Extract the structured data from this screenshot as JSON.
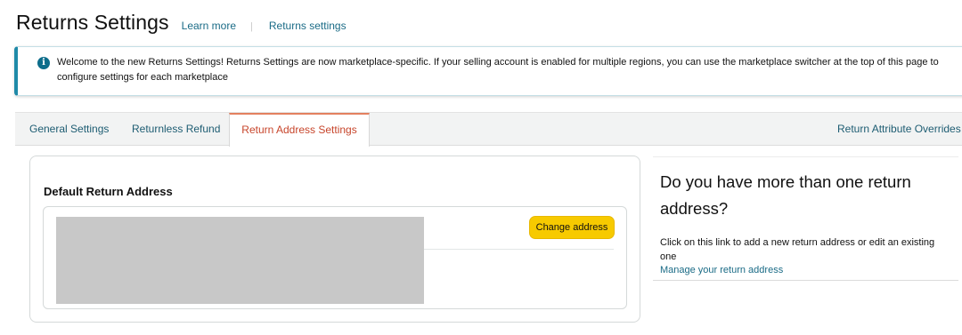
{
  "header": {
    "title": "Returns Settings",
    "learn_more": "Learn more",
    "separator": "|",
    "returns_settings_link": "Returns settings"
  },
  "alert": {
    "icon": "info-icon",
    "icon_glyph": "i",
    "message": "Welcome to the new Returns Settings! Returns Settings are now marketplace-specific. If your selling account is enabled for multiple regions, you can use the marketplace switcher at the top of this page to configure settings for each marketplace"
  },
  "tabs": {
    "items": [
      {
        "label": "General Settings",
        "active": false
      },
      {
        "label": "Returnless Refund",
        "active": false
      },
      {
        "label": "Return Address Settings",
        "active": true
      }
    ],
    "right_link": "Return Attribute Overrides"
  },
  "address_card": {
    "title": "Default Return Address",
    "change_button": "Change address"
  },
  "side": {
    "title": "Do you have more than one return address?",
    "text": "Click on this link to add a new return address or edit an existing one",
    "link": "Manage your return address"
  },
  "colors": {
    "accent": "#1f8aa8",
    "link": "#1a6b86",
    "active_tab": "#c7452b",
    "button": "#f7ca00"
  }
}
